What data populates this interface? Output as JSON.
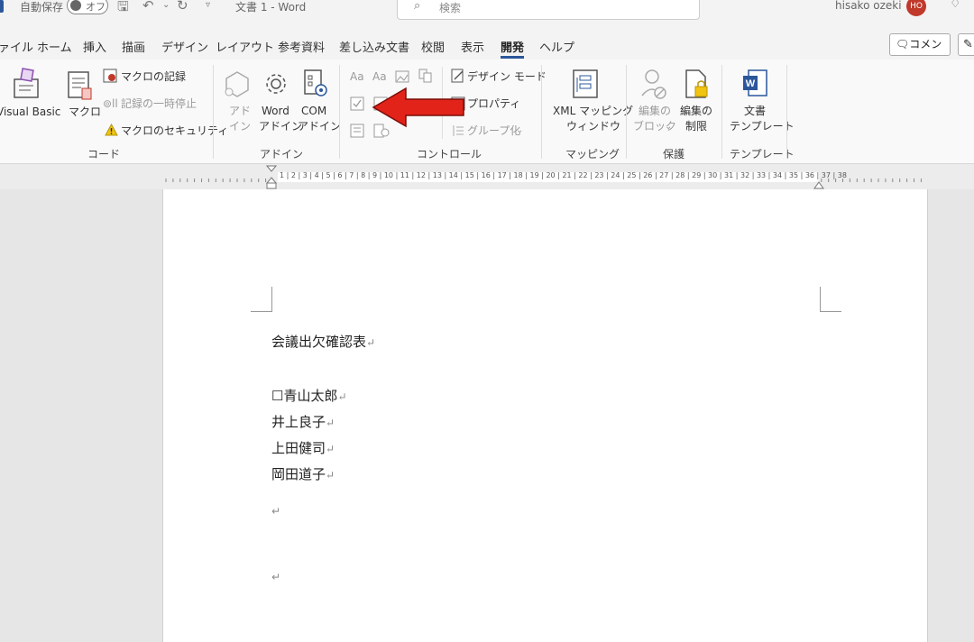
{
  "titlebar": {
    "autosave_label": "自動保存",
    "autosave_state": "オフ",
    "document_title": "文書 1  -  Word",
    "search_placeholder": "検索",
    "user_name": "hisako ozeki",
    "user_initials": "HO"
  },
  "menu": {
    "tabs": [
      "ァイル",
      "ホーム",
      "挿入",
      "描画",
      "デザイン",
      "レイアウト",
      "参考資料",
      "差し込み文書",
      "校閲",
      "表示",
      "開発",
      "ヘルプ"
    ],
    "active_tab": "開発",
    "comment_label": "コメント"
  },
  "ribbon": {
    "code": {
      "group_label": "コード",
      "visual_basic": "Visual Basic",
      "macro": "マクロ",
      "record_macro": "マクロの記録",
      "pause_recording": "記録の一時停止",
      "macro_security": "マクロのセキュリティ"
    },
    "addins": {
      "group_label": "アドイン",
      "addin_line1": "アド",
      "addin_line2": "イン",
      "word_addin_line1": "Word",
      "word_addin_line2": "アドイン",
      "com_addin_line1": "COM",
      "com_addin_line2": "アドイン"
    },
    "controls": {
      "group_label": "コントロール",
      "design_mode": "デザイン モード",
      "properties": "プロパティ",
      "group": "グループ化"
    },
    "mapping": {
      "group_label": "マッピング",
      "xml_line1": "XML マッピング",
      "xml_line2": "ウィンドウ"
    },
    "protect": {
      "group_label": "保護",
      "block_line1": "編集の",
      "block_line2": "ブロック",
      "restrict_line1": "編集の",
      "restrict_line2": "制限"
    },
    "templates": {
      "group_label": "テンプレート",
      "doc_template_line1": "文書",
      "doc_template_line2": "テンプレート"
    }
  },
  "ruler": {
    "numbers": "1 | 2 | 3 | 4 | 5 | 6 | 7 | 8 | 9 | 10 | 11 | 12 | 13 | 14 | 15 | 16 | 17 | 18 | 19 | 20 | 21 | 22 | 23 | 24 | 25 | 26 | 27 | 28 | 29 | 30 | 31 | 32 | 33 | 34 | 35 | 36 | 37 | 38"
  },
  "document": {
    "title": "会議出欠確認表",
    "lines": [
      "☐青山太郎",
      "井上良子",
      "上田健司",
      "岡田道子"
    ],
    "paragraph_mark": "↵"
  },
  "colors": {
    "accent": "#2b579a",
    "arrow": "#e2231a",
    "avatar": "#c0392b"
  },
  "icons": {
    "search": "search-icon",
    "save": "save-icon",
    "undo": "undo-icon",
    "redo": "redo-icon",
    "comment": "comment-icon",
    "pen": "pen-icon"
  }
}
